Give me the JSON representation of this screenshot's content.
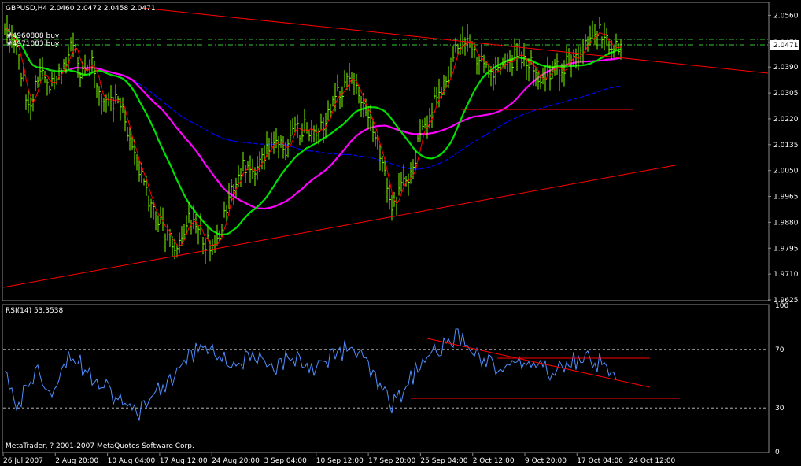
{
  "main_chart": {
    "header": "GBPUSD,H4  2.0460 2.0472 2.0458 2.0471",
    "order_labels": [
      "#4960808 buy",
      "#4971083 buy"
    ],
    "current_price": "2.0471",
    "y_ticks": [
      "2.0560",
      "2.0471",
      "2.0390",
      "2.0305",
      "2.0220",
      "2.0135",
      "2.0050",
      "1.9965",
      "1.9880",
      "1.9795",
      "1.9710",
      "1.9625"
    ],
    "x_ticks": [
      "26 Jul 2007",
      "2 Aug 20:00",
      "10 Aug 04:00",
      "17 Aug 12:00",
      "24 Aug 20:00",
      "3 Sep 04:00",
      "10 Sep 12:00",
      "17 Sep 20:00",
      "25 Sep 04:00",
      "2 Oct 12:00",
      "9 Oct 20:00",
      "17 Oct 04:00",
      "24 Oct 12:00"
    ],
    "copyright": "MetaTrader, ? 2001-2007 MetaQuotes Software Corp."
  },
  "rsi_panel": {
    "header": "RSI(14) 53.3538",
    "y_ticks": [
      "100",
      "70",
      "30",
      "0"
    ]
  },
  "colors": {
    "background": "#000000",
    "bars": "#7CFC00",
    "ma_fast": "#FF0000",
    "ma_mid": "#00E000",
    "ma_slow": "#FF00FF",
    "ma_long": "#0000FF",
    "trendline": "#FF0000",
    "rsi": "#4F8FFF",
    "grid_level": "#CCCCCC",
    "order_line": "#32CD32"
  },
  "chart_data": [
    {
      "type": "line",
      "title": "GBPUSD,H4",
      "ylim": [
        1.9625,
        2.06
      ],
      "x_categories": [
        "26 Jul 2007",
        "2 Aug 20:00",
        "10 Aug 04:00",
        "17 Aug 12:00",
        "24 Aug 20:00",
        "3 Sep 04:00",
        "10 Sep 12:00",
        "17 Sep 20:00",
        "25 Sep 04:00",
        "2 Oct 12:00",
        "9 Oct 20:00",
        "17 Oct 04:00",
        "24 Oct 12:00"
      ],
      "series": [
        {
          "values": [
            2.051,
            2.044,
            2.022,
            2.04,
            2.034,
            2.039,
            2.046,
            2.036,
            2.04,
            2.026,
            2.028,
            2.022,
            2.008,
            1.997,
            1.99,
            1.982,
            1.979,
            1.99,
            1.984,
            1.98,
            1.985,
            2.0,
            2.006,
            2.002,
            2.009,
            2.016,
            2.012,
            2.018,
            2.019,
            2.016,
            2.023,
            2.031,
            2.034,
            2.031,
            2.021,
            2.008,
            1.993,
            1.999,
            2.007,
            2.02,
            2.027,
            2.033,
            2.045,
            2.047,
            2.041,
            2.04,
            2.036,
            2.041,
            2.043,
            2.041,
            2.035,
            2.037,
            2.039,
            2.043,
            2.044,
            2.052,
            2.048,
            2.047
          ]
        }
      ]
    },
    {
      "type": "line",
      "title": "RSI(14)",
      "ylim": [
        0,
        100
      ],
      "series": [
        {
          "name": "RSI(14)",
          "values": [
            48,
            30,
            50,
            55,
            42,
            58,
            68,
            58,
            52,
            48,
            38,
            30,
            25,
            36,
            40,
            48,
            55,
            64,
            72,
            70,
            64,
            60,
            62,
            66,
            58,
            56,
            62,
            65,
            60,
            58,
            64,
            68,
            70,
            66,
            55,
            42,
            30,
            40,
            52,
            62,
            68,
            72,
            78,
            74,
            68,
            62,
            58,
            56,
            60,
            62,
            58,
            54,
            58,
            62,
            64,
            62,
            60,
            54
          ]
        }
      ]
    }
  ]
}
